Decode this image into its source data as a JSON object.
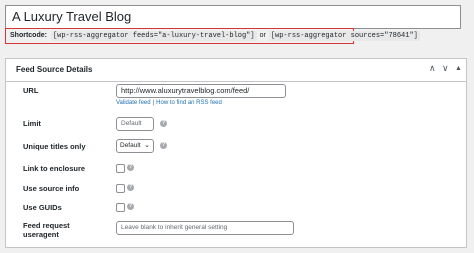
{
  "post_title": "A Luxury Travel Blog",
  "shortcode": {
    "label": "Shortcode:",
    "code1": "[wp-rss-aggregator feeds=\"a-luxury-travel-blog\"]",
    "or": "or",
    "code2": "[wp-rss-aggregator sources=\"78641\"]"
  },
  "panel": {
    "title": "Feed Source Details",
    "btn_up": "∧",
    "btn_down": "∨",
    "btn_toggle": "▲"
  },
  "fields": {
    "url_label": "URL",
    "url_value": "http://www.aluxurytravelblog.com/feed/",
    "validate_link": "Validate feed",
    "sep": "|",
    "howto_link": "How to find an RSS feed",
    "limit_label": "Limit",
    "limit_placeholder": "Default",
    "unique_label": "Unique titles only",
    "unique_value": "Default",
    "enclosure_label": "Link to enclosure",
    "source_info_label": "Use source info",
    "guids_label": "Use GUIDs",
    "useragent_label_1": "Feed request",
    "useragent_label_2": "useragent",
    "useragent_placeholder": "Leave blank to inherit general setting"
  }
}
